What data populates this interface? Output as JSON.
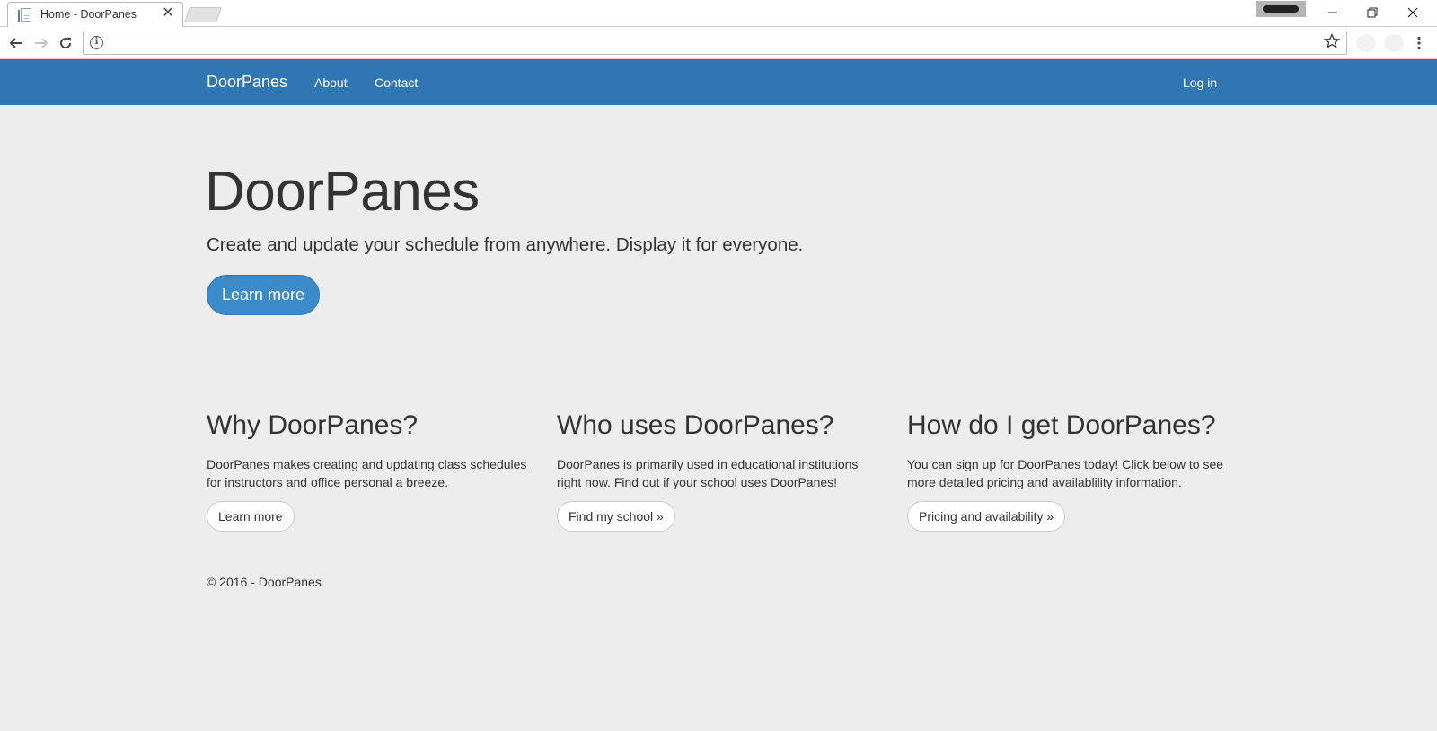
{
  "browser": {
    "tab_title": "Home - DoorPanes",
    "tab_close": "✕",
    "url": ""
  },
  "navbar": {
    "brand": "DoorPanes",
    "links": [
      "About",
      "Contact"
    ],
    "login": "Log in"
  },
  "hero": {
    "title": "DoorPanes",
    "lead": "Create and update your schedule from anywhere. Display it for everyone.",
    "button": "Learn more"
  },
  "columns": [
    {
      "heading": "Why DoorPanes?",
      "text": "DoorPanes makes creating and updating class schedules for instructors and office personal a breeze.",
      "button": "Learn more"
    },
    {
      "heading": "Who uses DoorPanes?",
      "text": "DoorPanes is primarily used in educational institutions right now. Find out if your school uses DoorPanes!",
      "button": "Find my school »"
    },
    {
      "heading": "How do I get DoorPanes?",
      "text": "You can sign up for DoorPanes today! Click below to see more detailed pricing and availablility information.",
      "button": "Pricing and availability »"
    }
  ],
  "footer": "© 2016 - DoorPanes",
  "colors": {
    "navbar": "#2f76b2",
    "page_bg": "#ededed",
    "primary_button": "#3b8bcb"
  }
}
